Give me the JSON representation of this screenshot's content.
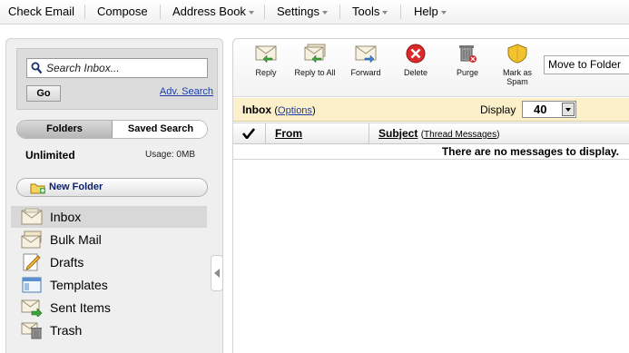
{
  "menu": {
    "items": [
      {
        "label": "Check Email"
      },
      {
        "label": "Compose"
      },
      {
        "label": "Address Book"
      },
      {
        "label": "Settings"
      },
      {
        "label": "Tools"
      },
      {
        "label": "Help"
      }
    ]
  },
  "search": {
    "placeholder": "Search Inbox...",
    "go_label": "Go",
    "adv_label": "Adv. Search"
  },
  "tabs": {
    "folders": "Folders",
    "saved": "Saved Search"
  },
  "quota": {
    "label": "Unlimited",
    "usage": "Usage: 0MB"
  },
  "new_folder_label": "New Folder",
  "folders": [
    {
      "label": "Inbox",
      "icon": "inbox-icon",
      "selected": true
    },
    {
      "label": "Bulk Mail",
      "icon": "bulk-mail-icon"
    },
    {
      "label": "Drafts",
      "icon": "drafts-icon"
    },
    {
      "label": "Templates",
      "icon": "templates-icon"
    },
    {
      "label": "Sent Items",
      "icon": "sent-items-icon"
    },
    {
      "label": "Trash",
      "icon": "trash-icon"
    }
  ],
  "toolbar": {
    "reply": "Reply",
    "reply_all": "Reply to All",
    "forward": "Forward",
    "delete": "Delete",
    "purge": "Purge",
    "spam_line1": "Mark as",
    "spam_line2": "Spam",
    "move_folder": "Move to Folder"
  },
  "inbox_bar": {
    "title": "Inbox",
    "options": "Options",
    "display_label": "Display",
    "display_value": "40"
  },
  "grid": {
    "from": "From",
    "subject": "Subject",
    "thread": "Thread Messages",
    "empty": "There are no messages to display."
  },
  "colors": {
    "accent_link": "#1d3ea8",
    "inbox_bar_bg": "#fbf0c9",
    "selected_folder_bg": "#d8d8d8",
    "delete_red": "#d92b2b",
    "spam_yellow": "#f2c230"
  }
}
